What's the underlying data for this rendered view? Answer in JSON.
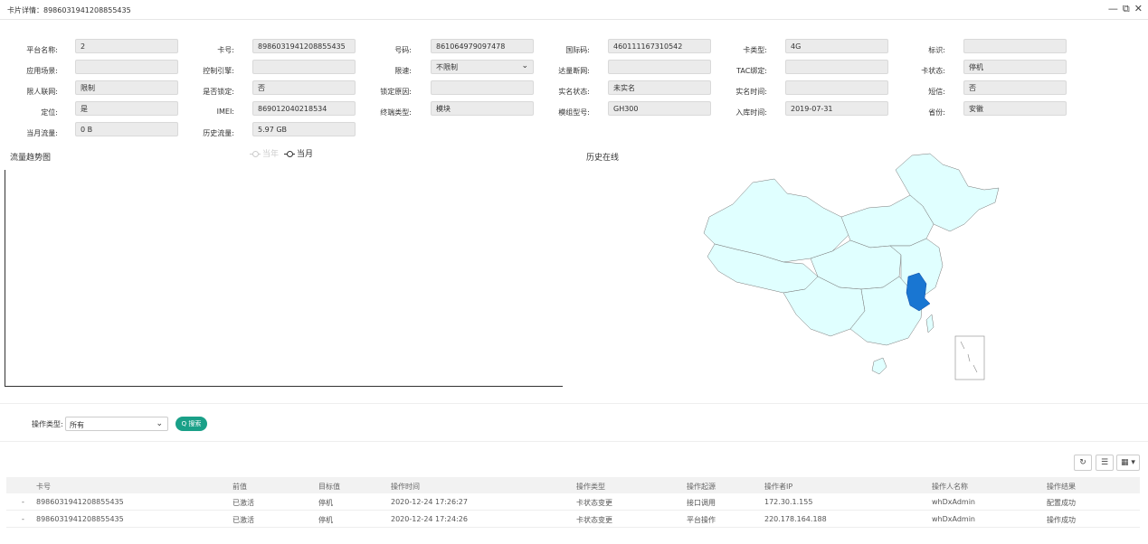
{
  "window": {
    "title": "卡片详情：8986031941208855435",
    "min_glyph": "—",
    "max_glyph": "⧉",
    "close_glyph": "✕"
  },
  "fields": {
    "platform_name": {
      "label": "平台名称:",
      "value": "2"
    },
    "card_no": {
      "label": "卡号:",
      "value": "8986031941208855435"
    },
    "number": {
      "label": "号码:",
      "value": "861064979097478"
    },
    "imsi": {
      "label": "国际码:",
      "value": "460111167310542"
    },
    "card_type": {
      "label": "卡类型:",
      "value": "4G"
    },
    "mark": {
      "label": "标识:",
      "value": ""
    },
    "scene": {
      "label": "应用场景:",
      "value": ""
    },
    "control_engine": {
      "label": "控制引擎:",
      "value": ""
    },
    "speed_limit": {
      "label": "限速:",
      "value": "不限制"
    },
    "reach_disconnect": {
      "label": "达量断网:",
      "value": ""
    },
    "tac_bind": {
      "label": "TAC绑定:",
      "value": ""
    },
    "card_status": {
      "label": "卡状态:",
      "value": "停机"
    },
    "limit_net": {
      "label": "限人联网:",
      "value": "限制"
    },
    "locked": {
      "label": "是否锁定:",
      "value": "否"
    },
    "lock_reason": {
      "label": "锁定原因:",
      "value": ""
    },
    "realname_status": {
      "label": "实名状态:",
      "value": "未实名"
    },
    "realname_time": {
      "label": "实名时间:",
      "value": ""
    },
    "sms": {
      "label": "短信:",
      "value": "否"
    },
    "locate": {
      "label": "定位:",
      "value": "是"
    },
    "imei": {
      "label": "IMEI:",
      "value": "869012040218534"
    },
    "terminal_type": {
      "label": "终端类型:",
      "value": "模块"
    },
    "module_model": {
      "label": "模组型号:",
      "value": "GH300"
    },
    "storage_time": {
      "label": "入库时间:",
      "value": "2019-07-31"
    },
    "province": {
      "label": "省份:",
      "value": "安徽"
    },
    "month_traffic": {
      "label": "当月流量:",
      "value": "0 B"
    },
    "history_traffic": {
      "label": "历史流量:",
      "value": "5.97 GB"
    }
  },
  "traffic_chart": {
    "title": "流量趋势图",
    "legend": [
      {
        "label": "当年",
        "active": false
      },
      {
        "label": "当月",
        "active": true
      }
    ]
  },
  "history_map": {
    "title": "历史在线",
    "base_color": "#e0ffff",
    "highlight_color": "#1976d2"
  },
  "filter": {
    "label": "操作类型:",
    "selected": "所有",
    "search_label": "Q 搜索"
  },
  "toolbar": {
    "refresh_glyph": "↻",
    "list_glyph": "☰",
    "columns_glyph": "▦ ▾"
  },
  "table": {
    "columns": [
      "卡号",
      "前值",
      "目标值",
      "操作时间",
      "操作类型",
      "操作起源",
      "操作者IP",
      "操作人名称",
      "操作结果"
    ],
    "rows": [
      {
        "dash": "-",
        "cells": [
          "8986031941208855435",
          "已激活",
          "停机",
          "2020-12-24 17:26:27",
          "卡状态变更",
          "接口调用",
          "172.30.1.155",
          "whDxAdmin",
          "配置成功"
        ]
      },
      {
        "dash": "-",
        "cells": [
          "8986031941208855435",
          "已激活",
          "停机",
          "2020-12-24 17:24:26",
          "卡状态变更",
          "平台操作",
          "220.178.164.188",
          "whDxAdmin",
          "操作成功"
        ]
      }
    ]
  }
}
